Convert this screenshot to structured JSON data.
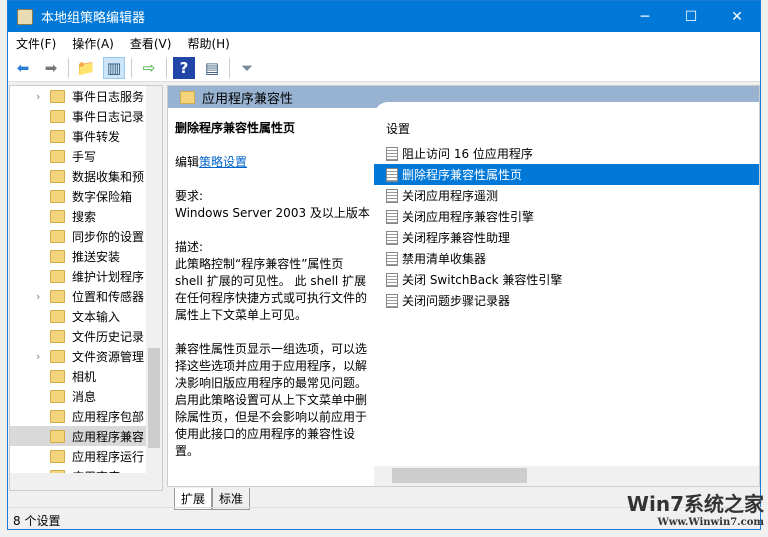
{
  "window": {
    "title": "本地组策略编辑器",
    "min": "─",
    "max": "☐",
    "close": "✕"
  },
  "menu": [
    "文件(F)",
    "操作(A)",
    "查看(V)",
    "帮助(H)"
  ],
  "tree": [
    {
      "label": "事件日志服务",
      "expand": "›"
    },
    {
      "label": "事件日志记录",
      "expand": ""
    },
    {
      "label": "事件转发",
      "expand": ""
    },
    {
      "label": "手写",
      "expand": ""
    },
    {
      "label": "数据收集和预",
      "expand": ""
    },
    {
      "label": "数字保险箱",
      "expand": ""
    },
    {
      "label": "搜索",
      "expand": ""
    },
    {
      "label": "同步你的设置",
      "expand": ""
    },
    {
      "label": "推送安装",
      "expand": ""
    },
    {
      "label": "维护计划程序",
      "expand": ""
    },
    {
      "label": "位置和传感器",
      "expand": "›"
    },
    {
      "label": "文本输入",
      "expand": ""
    },
    {
      "label": "文件历史记录",
      "expand": ""
    },
    {
      "label": "文件资源管理",
      "expand": "›"
    },
    {
      "label": "相机",
      "expand": ""
    },
    {
      "label": "消息",
      "expand": ""
    },
    {
      "label": "应用程序包部",
      "expand": ""
    },
    {
      "label": "应用程序兼容",
      "expand": ""
    },
    {
      "label": "应用程序运行",
      "expand": ""
    },
    {
      "label": "应用商店",
      "expand": ""
    }
  ],
  "header": "应用程序兼容性",
  "desc": {
    "title": "删除程序兼容性属性页",
    "edit": "编辑",
    "edit_link": "策略设置",
    "req_label": "要求:",
    "req": "Windows Server 2003 及以上版本",
    "desc_label": "描述:",
    "p1": "此策略控制“程序兼容性”属性页 shell 扩展的可见性。 此 shell 扩展在任何程序快捷方式或可执行文件的属性上下文菜单上可见。",
    "p2": "兼容性属性页显示一组选项，可以选择这些选项并应用于应用程序，以解决影响旧版应用程序的最常见问题。启用此策略设置可从上下文菜单中删除属性页，但是不会影响以前应用于使用此接口的应用程序的兼容性设置。"
  },
  "list": {
    "header": "设置",
    "items": [
      "阻止访问 16 位应用程序",
      "删除程序兼容性属性页",
      "关闭应用程序遥测",
      "关闭应用程序兼容性引擎",
      "关闭程序兼容性助理",
      "禁用清单收集器",
      "关闭 SwitchBack 兼容性引擎",
      "关闭问题步骤记录器"
    ]
  },
  "tabs": [
    "扩展",
    "标准"
  ],
  "status": "8 个设置",
  "watermark": {
    "brand": "Win7系统之家",
    "url": "Www.Winwin7.com"
  }
}
